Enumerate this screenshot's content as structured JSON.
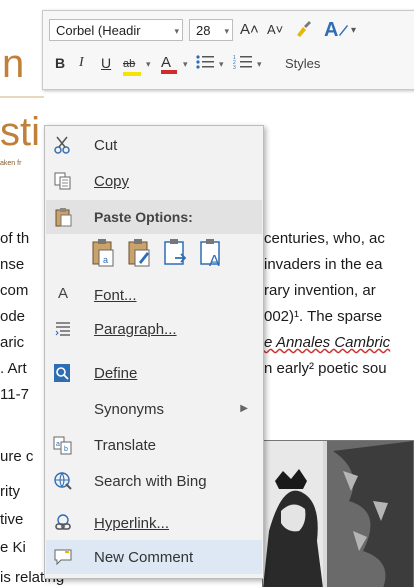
{
  "document": {
    "title_fragments": [
      "n",
      "sti"
    ],
    "caption_fragment": "aken fr",
    "lines_left": [
      "of th",
      "nse",
      "com",
      "ode",
      "aric",
      ". Art",
      "11-7",
      "ure c",
      "rity",
      "tive",
      "e Ki",
      "is relating"
    ],
    "lines_right": [
      "centuries, who, ac",
      "invaders in the ea",
      "rary invention, ar",
      "002)¹. The sparse",
      "e Annales Cambric",
      "n early² poetic sou"
    ]
  },
  "toolbar": {
    "font_name": "Corbel (Headir",
    "font_size": "28",
    "grow_font": "A˄",
    "shrink_font": "A˅",
    "styles_label": "Styles",
    "bold": "B",
    "italic": "I",
    "underline": "U",
    "highlight": "ab",
    "font_color": "A"
  },
  "menu": {
    "items": [
      {
        "label": "Cut",
        "icon": "scissors-icon"
      },
      {
        "label": "Copy",
        "icon": "copy-icon"
      },
      {
        "label": "Paste Options:",
        "icon": "clipboard-icon"
      },
      {
        "label": "Font...",
        "icon": "font-icon"
      },
      {
        "label": "Paragraph...",
        "icon": "paragraph-icon"
      },
      {
        "label": "Define",
        "icon": "define-icon"
      },
      {
        "label": "Synonyms",
        "icon": ""
      },
      {
        "label": "Translate",
        "icon": "translate-icon"
      },
      {
        "label": "Search with Bing",
        "icon": "search-icon"
      },
      {
        "label": "Hyperlink...",
        "icon": "hyperlink-icon"
      },
      {
        "label": "New Comment",
        "icon": "comment-icon"
      }
    ],
    "paste_icon_names": [
      "keep-source-formatting-icon",
      "merge-formatting-icon",
      "picture-icon",
      "keep-text-only-icon"
    ]
  },
  "colors": {
    "accent_blue": "#2e6db4",
    "title_orange": "#c0803a",
    "highlight_yellow": "#f5e400",
    "font_red": "#d22b2b",
    "menu_hover": "#dde8f4"
  }
}
